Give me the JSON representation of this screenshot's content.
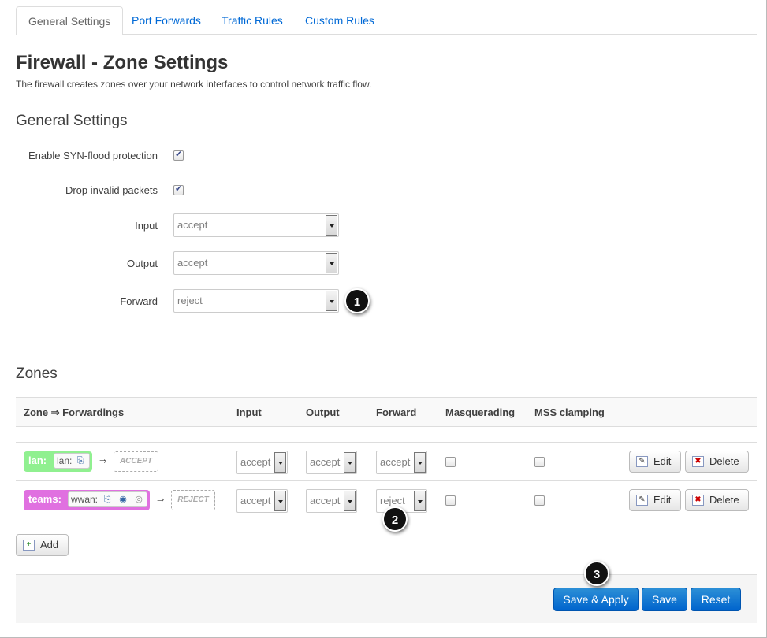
{
  "tabs": [
    "General Settings",
    "Port Forwards",
    "Traffic Rules",
    "Custom Rules"
  ],
  "page": {
    "title": "Firewall - Zone Settings",
    "description": "The firewall creates zones over your network interfaces to control network traffic flow."
  },
  "general": {
    "heading": "General Settings",
    "syn_label": "Enable SYN-flood protection",
    "drop_label": "Drop invalid packets",
    "input_label": "Input",
    "input_value": "accept",
    "output_label": "Output",
    "output_value": "accept",
    "forward_label": "Forward",
    "forward_value": "reject"
  },
  "zones": {
    "heading": "Zones",
    "columns": [
      "Zone ⇒ Forwardings",
      "Input",
      "Output",
      "Forward",
      "Masquerading",
      "MSS clamping"
    ],
    "rows": [
      {
        "name": "lan:",
        "interfaces": "lan:",
        "target": "ACCEPT",
        "input": "accept",
        "output": "accept",
        "forward": "accept",
        "color": "#90f090"
      },
      {
        "name": "teams:",
        "interfaces": "wwan:",
        "target": "REJECT",
        "input": "accept",
        "output": "accept",
        "forward": "reject",
        "color": "#e070e0"
      }
    ],
    "arrow": "⇒",
    "edit_label": "Edit",
    "delete_label": "Delete",
    "add_label": "Add"
  },
  "footer": {
    "save_apply": "Save & Apply",
    "save": "Save",
    "reset": "Reset"
  },
  "callouts": [
    "1",
    "2",
    "3"
  ],
  "colors": {
    "link": "#0069d6",
    "primary": "#0064cd"
  }
}
